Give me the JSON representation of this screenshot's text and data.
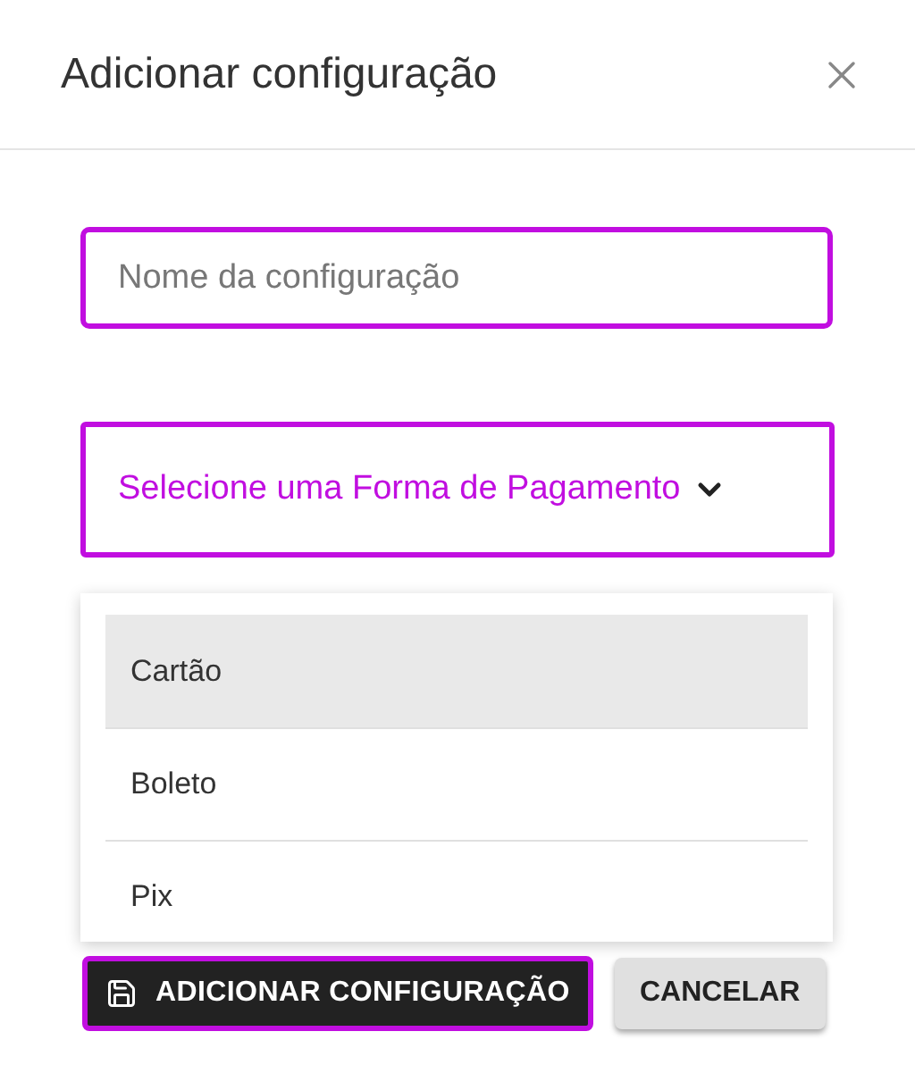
{
  "dialog": {
    "title": "Adicionar configuração"
  },
  "name_field": {
    "placeholder": "Nome da configuração"
  },
  "payment_select": {
    "label": "Selecione uma Forma de Pagamento",
    "expanded": true
  },
  "options": [
    {
      "label": "Cartão",
      "selected": true
    },
    {
      "label": "Boleto",
      "selected": false
    },
    {
      "label": "Pix",
      "selected": false
    }
  ],
  "buttons": [
    {
      "label": "ADICIONAR CONFIGURAÇÃO",
      "kind": "primary"
    },
    {
      "label": "CANCELAR",
      "kind": "secondary"
    }
  ]
}
